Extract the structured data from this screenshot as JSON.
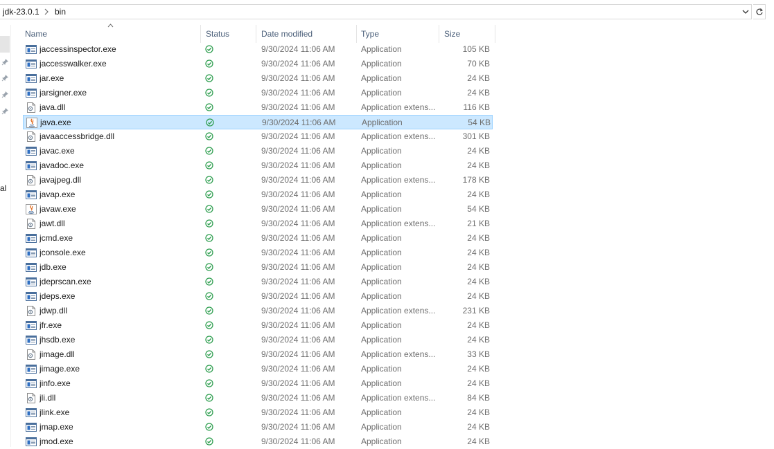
{
  "address_bar": {
    "crumbs": [
      "jdk-23.0.1",
      "bin"
    ]
  },
  "nav": {
    "partial_label": "al"
  },
  "columns": {
    "name": "Name",
    "status": "Status",
    "date": "Date modified",
    "type": "Type",
    "size": "Size"
  },
  "selected_file": "java.exe",
  "colors": {
    "selection_bg": "#cce8ff",
    "selection_border": "#99d1ff",
    "status_green": "#2e9e4f",
    "header_text": "#4c607a"
  },
  "files": [
    {
      "name": "jaccessinspector.exe",
      "date": "9/30/2024 11:06 AM",
      "type": "Application",
      "size": "105 KB",
      "icon": "exe-icon"
    },
    {
      "name": "jaccesswalker.exe",
      "date": "9/30/2024 11:06 AM",
      "type": "Application",
      "size": "70 KB",
      "icon": "exe-icon"
    },
    {
      "name": "jar.exe",
      "date": "9/30/2024 11:06 AM",
      "type": "Application",
      "size": "24 KB",
      "icon": "exe-icon"
    },
    {
      "name": "jarsigner.exe",
      "date": "9/30/2024 11:06 AM",
      "type": "Application",
      "size": "24 KB",
      "icon": "exe-icon"
    },
    {
      "name": "java.dll",
      "date": "9/30/2024 11:06 AM",
      "type": "Application extens...",
      "size": "116 KB",
      "icon": "dll-icon"
    },
    {
      "name": "java.exe",
      "date": "9/30/2024 11:06 AM",
      "type": "Application",
      "size": "54 KB",
      "icon": "java-icon"
    },
    {
      "name": "javaaccessbridge.dll",
      "date": "9/30/2024 11:06 AM",
      "type": "Application extens...",
      "size": "301 KB",
      "icon": "dll-icon"
    },
    {
      "name": "javac.exe",
      "date": "9/30/2024 11:06 AM",
      "type": "Application",
      "size": "24 KB",
      "icon": "exe-icon"
    },
    {
      "name": "javadoc.exe",
      "date": "9/30/2024 11:06 AM",
      "type": "Application",
      "size": "24 KB",
      "icon": "exe-icon"
    },
    {
      "name": "javajpeg.dll",
      "date": "9/30/2024 11:06 AM",
      "type": "Application extens...",
      "size": "178 KB",
      "icon": "dll-icon"
    },
    {
      "name": "javap.exe",
      "date": "9/30/2024 11:06 AM",
      "type": "Application",
      "size": "24 KB",
      "icon": "exe-icon"
    },
    {
      "name": "javaw.exe",
      "date": "9/30/2024 11:06 AM",
      "type": "Application",
      "size": "54 KB",
      "icon": "java-icon"
    },
    {
      "name": "jawt.dll",
      "date": "9/30/2024 11:06 AM",
      "type": "Application extens...",
      "size": "21 KB",
      "icon": "dll-icon"
    },
    {
      "name": "jcmd.exe",
      "date": "9/30/2024 11:06 AM",
      "type": "Application",
      "size": "24 KB",
      "icon": "exe-icon"
    },
    {
      "name": "jconsole.exe",
      "date": "9/30/2024 11:06 AM",
      "type": "Application",
      "size": "24 KB",
      "icon": "exe-icon"
    },
    {
      "name": "jdb.exe",
      "date": "9/30/2024 11:06 AM",
      "type": "Application",
      "size": "24 KB",
      "icon": "exe-icon"
    },
    {
      "name": "jdeprscan.exe",
      "date": "9/30/2024 11:06 AM",
      "type": "Application",
      "size": "24 KB",
      "icon": "exe-icon"
    },
    {
      "name": "jdeps.exe",
      "date": "9/30/2024 11:06 AM",
      "type": "Application",
      "size": "24 KB",
      "icon": "exe-icon"
    },
    {
      "name": "jdwp.dll",
      "date": "9/30/2024 11:06 AM",
      "type": "Application extens...",
      "size": "231 KB",
      "icon": "dll-icon"
    },
    {
      "name": "jfr.exe",
      "date": "9/30/2024 11:06 AM",
      "type": "Application",
      "size": "24 KB",
      "icon": "exe-icon"
    },
    {
      "name": "jhsdb.exe",
      "date": "9/30/2024 11:06 AM",
      "type": "Application",
      "size": "24 KB",
      "icon": "exe-icon"
    },
    {
      "name": "jimage.dll",
      "date": "9/30/2024 11:06 AM",
      "type": "Application extens...",
      "size": "33 KB",
      "icon": "dll-icon"
    },
    {
      "name": "jimage.exe",
      "date": "9/30/2024 11:06 AM",
      "type": "Application",
      "size": "24 KB",
      "icon": "exe-icon"
    },
    {
      "name": "jinfo.exe",
      "date": "9/30/2024 11:06 AM",
      "type": "Application",
      "size": "24 KB",
      "icon": "exe-icon"
    },
    {
      "name": "jli.dll",
      "date": "9/30/2024 11:06 AM",
      "type": "Application extens...",
      "size": "84 KB",
      "icon": "dll-icon"
    },
    {
      "name": "jlink.exe",
      "date": "9/30/2024 11:06 AM",
      "type": "Application",
      "size": "24 KB",
      "icon": "exe-icon"
    },
    {
      "name": "jmap.exe",
      "date": "9/30/2024 11:06 AM",
      "type": "Application",
      "size": "24 KB",
      "icon": "exe-icon"
    },
    {
      "name": "jmod.exe",
      "date": "9/30/2024 11:06 AM",
      "type": "Application",
      "size": "24 KB",
      "icon": "exe-icon"
    }
  ]
}
